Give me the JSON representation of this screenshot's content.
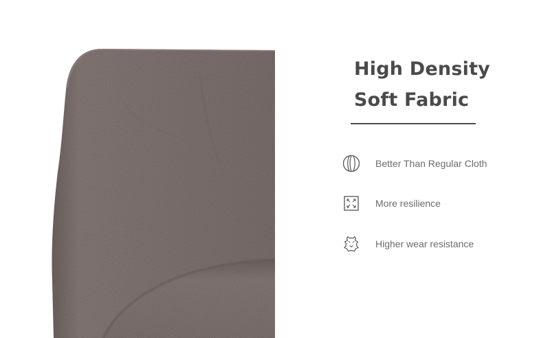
{
  "headline": {
    "line1": "High Density",
    "line2": "Soft Fabric"
  },
  "features": [
    {
      "icon": "fabric-layers-icon",
      "label": "Better Than Regular Cloth"
    },
    {
      "icon": "expand-arrows-icon",
      "label": "More resilience"
    },
    {
      "icon": "leather-hide-icon",
      "label": "Higher wear resistance"
    }
  ],
  "colors": {
    "background": "#ffffff",
    "fabric": "#7d716f",
    "heading": "#4a4a4a",
    "text": "#6b6b6b",
    "divider": "#4d4d4d"
  }
}
